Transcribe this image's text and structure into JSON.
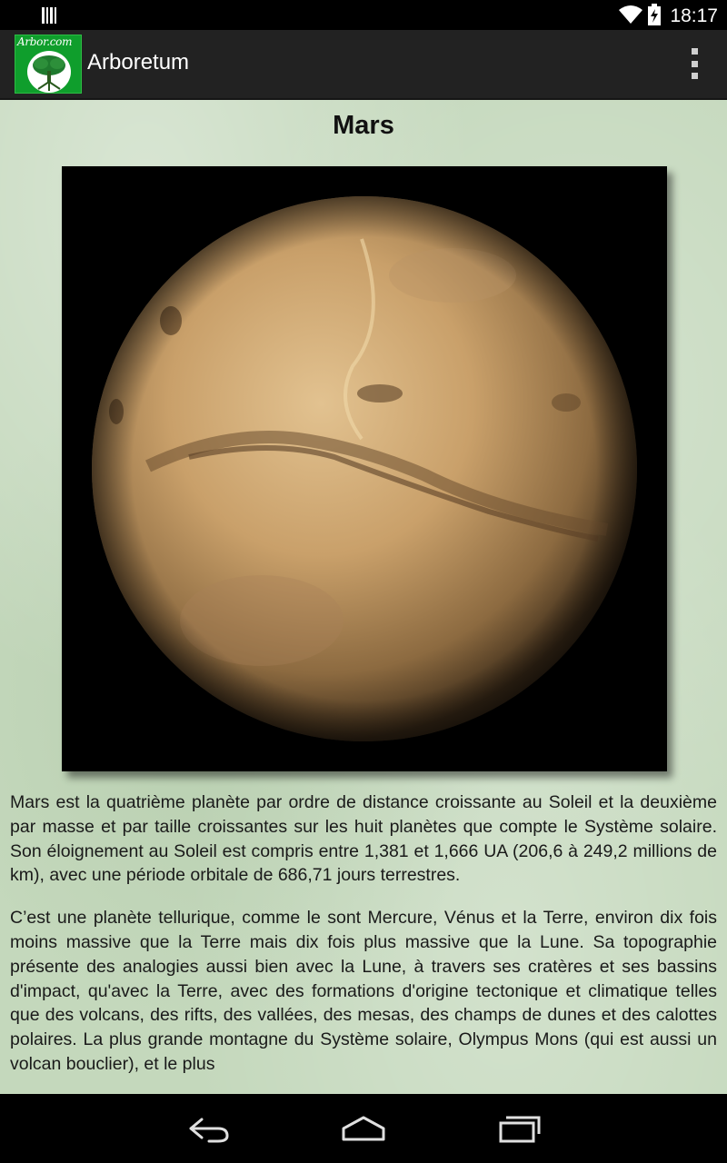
{
  "status_bar": {
    "time": "18:17",
    "icons": [
      "barcode-icon",
      "wifi-icon",
      "battery-charging-icon"
    ]
  },
  "action_bar": {
    "app_icon_text": "Arbor.com",
    "title": "Arboretum",
    "menu_icon": "overflow-menu-icon"
  },
  "page": {
    "title": "Mars",
    "paragraphs": [
      "Mars est la quatrième planète par ordre de distance croissante au Soleil et la deuxième par masse et par taille croissantes sur les huit planètes que compte le Système solaire. Son éloignement au Soleil est compris entre 1,381 et 1,666 UA (206,6 à 249,2 millions de km), avec une période orbitale de 686,71 jours terrestres.",
      "C’est une planète tellurique, comme le sont Mercure, Vénus et la Terre, environ dix fois moins massive que la Terre mais dix fois plus massive que la Lune. Sa topographie présente des analogies aussi bien avec la Lune, à travers ses cratères et ses bassins d'impact, qu'avec la Terre, avec des formations d'origine tectonique et climatique telles que des volcans, des rifts, des vallées, des mesas, des champs de dunes et des calottes polaires. La plus grande montagne du Système solaire, Olympus Mons (qui est aussi un volcan bouclier), et le plus"
    ]
  },
  "nav_bar": {
    "icons": [
      "back-icon",
      "home-icon",
      "recent-apps-icon"
    ]
  },
  "colors": {
    "action_bar": "#222222",
    "app_icon_bg": "#0f9e2c",
    "content_bg": "#c4d8bc",
    "text": "#1a1a1a"
  }
}
